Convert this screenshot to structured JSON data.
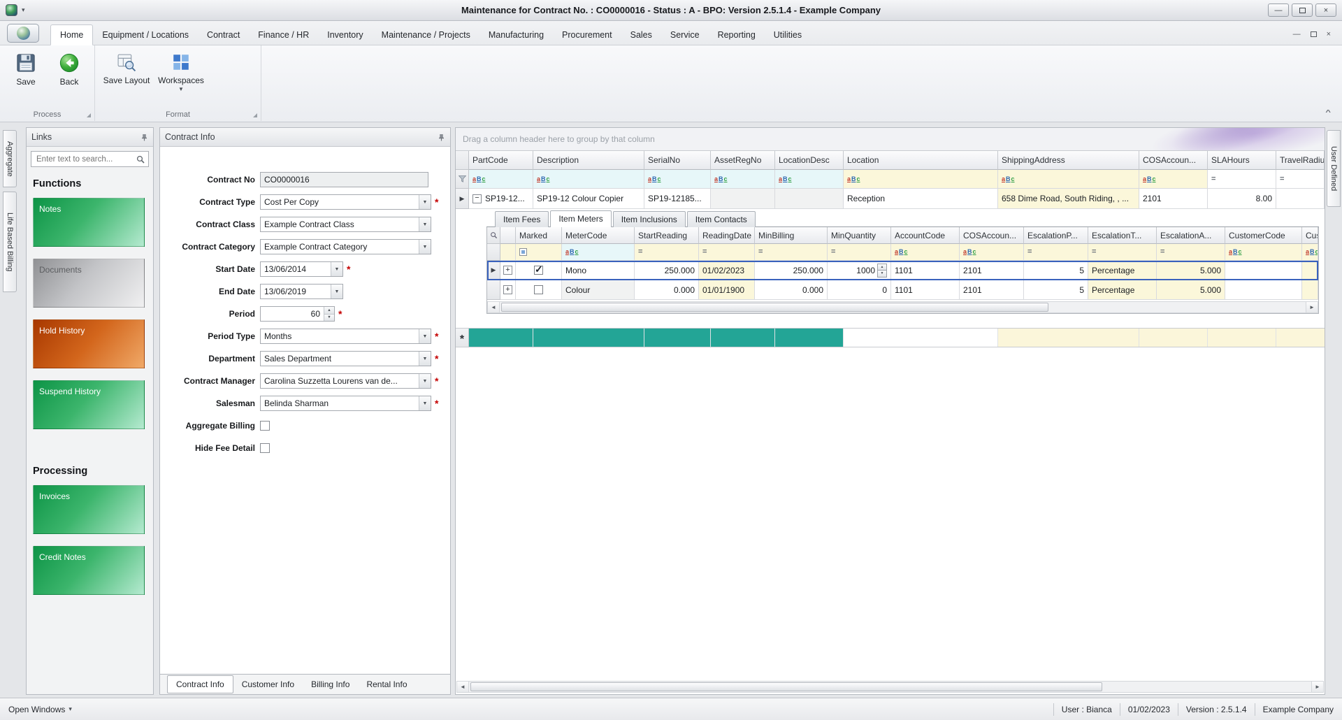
{
  "window": {
    "title": "Maintenance for Contract No. : CO0000016 - Status : A - BPO: Version 2.5.1.4 - Example Company"
  },
  "ribbon": {
    "tabs": [
      "Home",
      "Equipment / Locations",
      "Contract",
      "Finance / HR",
      "Inventory",
      "Maintenance / Projects",
      "Manufacturing",
      "Procurement",
      "Sales",
      "Service",
      "Reporting",
      "Utilities"
    ],
    "buttons": {
      "save": "Save",
      "back": "Back",
      "save_layout": "Save Layout",
      "workspaces": "Workspaces"
    },
    "groups": {
      "process": "Process",
      "format": "Format"
    }
  },
  "side_tabs": {
    "left": [
      "Aggregate",
      "Life Based Billing"
    ],
    "right": [
      "User Defined"
    ]
  },
  "links": {
    "title": "Links",
    "search_placeholder": "Enter text to search...",
    "functions_heading": "Functions",
    "processing_heading": "Processing",
    "buttons": {
      "notes": "Notes",
      "documents": "Documents",
      "hold_history": "Hold History",
      "suspend_history": "Suspend History",
      "invoices": "Invoices",
      "credit_notes": "Credit Notes"
    }
  },
  "contract": {
    "title": "Contract Info",
    "labels": {
      "contract_no": "Contract No",
      "contract_type": "Contract Type",
      "contract_class": "Contract Class",
      "contract_category": "Contract Category",
      "start_date": "Start Date",
      "end_date": "End Date",
      "period": "Period",
      "period_type": "Period Type",
      "department": "Department",
      "contract_manager": "Contract Manager",
      "salesman": "Salesman",
      "aggregate_billing": "Aggregate Billing",
      "hide_fee_detail": "Hide Fee Detail"
    },
    "values": {
      "contract_no": "CO0000016",
      "contract_type": "Cost Per Copy",
      "contract_class": "Example Contract Class",
      "contract_category": "Example Contract Category",
      "start_date": "13/06/2014",
      "end_date": "13/06/2019",
      "period": "60",
      "period_type": "Months",
      "department": "Sales Department",
      "contract_manager": "Carolina Suzzetta Lourens van de...",
      "salesman": "Belinda Sharman"
    },
    "bottom_tabs": [
      "Contract Info",
      "Customer Info",
      "Billing Info",
      "Rental Info"
    ]
  },
  "grid": {
    "group_hint": "Drag a column header here to group by that column",
    "columns": [
      "PartCode",
      "Description",
      "SerialNo",
      "AssetRegNo",
      "LocationDesc",
      "Location",
      "ShippingAddress",
      "COSAccoun...",
      "SLAHours",
      "TravelRadiu..."
    ],
    "row": {
      "part": "SP19-12...",
      "desc": "SP19-12 Colour Copier",
      "serial": "SP19-12185...",
      "assetreg": "",
      "locdesc": "",
      "location": "Reception",
      "shipping": "658 Dime Road, South Riding, , ...",
      "cos": "2101",
      "sla": "8.00",
      "travel": ""
    },
    "detail": {
      "tabs": [
        "Item Fees",
        "Item Meters",
        "Item Inclusions",
        "Item Contacts"
      ],
      "columns": [
        "Marked",
        "MeterCode",
        "StartReading",
        "ReadingDate",
        "MinBilling",
        "MinQuantity",
        "AccountCode",
        "COSAccoun...",
        "EscalationP...",
        "EscalationT...",
        "EscalationA...",
        "CustomerCode",
        "Cus..."
      ],
      "rows": [
        {
          "marked": true,
          "meter": "Mono",
          "start": "250.000",
          "rdate": "01/02/2023",
          "minbill": "250.000",
          "minqty": "1000",
          "acct": "1101",
          "cos": "2101",
          "escp": "5",
          "esct": "Percentage",
          "esca": "5.000",
          "cust": ""
        },
        {
          "marked": false,
          "meter": "Colour",
          "start": "0.000",
          "rdate": "01/01/1900",
          "minbill": "0.000",
          "minqty": "0",
          "acct": "1101",
          "cos": "2101",
          "escp": "5",
          "esct": "Percentage",
          "esca": "5.000",
          "cust": ""
        }
      ]
    }
  },
  "status": {
    "open_windows": "Open Windows",
    "user": "User : Bianca",
    "date": "01/02/2023",
    "version": "Version : 2.5.1.4",
    "company": "Example Company"
  }
}
